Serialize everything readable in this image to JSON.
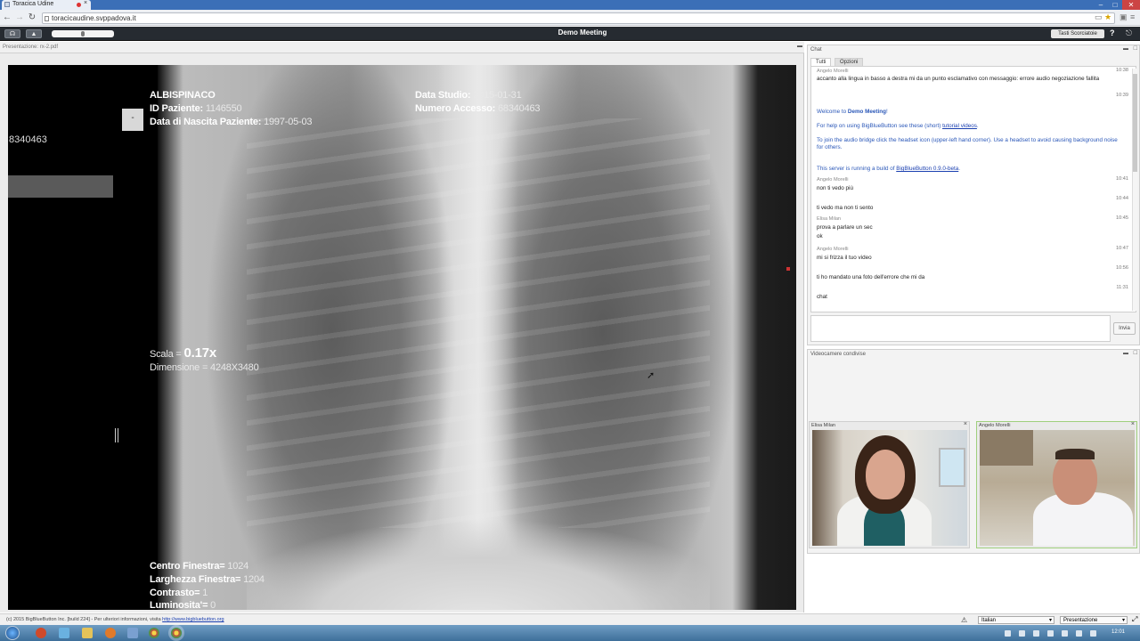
{
  "browser": {
    "tab_title": "Toracica Udine",
    "url": "toracicaudine.svppadova.it"
  },
  "app": {
    "meeting_title": "Demo Meeting",
    "shortcuts_label": "Tasti Scorciatoie",
    "help_label": "?"
  },
  "presentation": {
    "file_name": "Presentazione: rx-2.pdf",
    "minimize_label": "-",
    "overlay": {
      "left_id": "8340463",
      "patient_name": "ALBISPINACO",
      "id_label": "ID Paziente:",
      "id_value": "1146550",
      "birth_label": "Data di Nascita Paziente:",
      "birth_value": "1997-05-03",
      "study_label": "Data Studio:",
      "study_value": "2015-01-31",
      "access_label": "Numero Accesso:",
      "access_value": "68340463",
      "scale_label": "Scala =",
      "scale_value": "0.17x",
      "dim_label": "Dimensione =",
      "dim_value": "4248X3480",
      "center_label": "Centro Finestra=",
      "center_value": "1024",
      "width_label": "Larghezza Finestra=",
      "width_value": "1204",
      "contrast_label": "Contrasto=",
      "contrast_value": "1",
      "lum_label": "Luminosita'=",
      "lum_value": "0"
    }
  },
  "chat": {
    "title": "Chat",
    "tabs": [
      "Tutti",
      "Opzioni"
    ],
    "messages": [
      {
        "sender": "Angelo Morelli",
        "time": "10:38",
        "text": "accanto alla lingua in basso a destra mi da un punto esclamativo con messaggio: errore audio negoziazione fallita"
      },
      {
        "time": "10:39"
      },
      {
        "text_a": "Welcome to ",
        "text_b": "Demo Meeting",
        "text_c": "!"
      },
      {
        "text_a": "For help on using BigBlueButton see these (short) ",
        "link": "tutorial videos",
        "text_c": "."
      },
      {
        "text": "To join the audio bridge click the headset icon (upper-left hand corner).  Use a headset to avoid causing background noise for others."
      },
      {
        "text_a": "This server is running a build of ",
        "link": "BigBlueButton 0.9.0-beta",
        "text_c": "."
      },
      {
        "sender": "Angelo Morelli",
        "time": "10:41",
        "text": "non ti vedo più"
      },
      {
        "time": "10:44",
        "text": "ti vedo ma non ti sento"
      },
      {
        "sender": "Elisa Milan",
        "time": "10:45",
        "text": "prova a parlare un sec"
      },
      {
        "text": "ok"
      },
      {
        "sender": "Angelo Morelli",
        "time": "10:47",
        "text": "mi si frizza il tuo video"
      },
      {
        "time": "10:56",
        "text": "ti ho mandato una foto dell'errore che mi da"
      },
      {
        "time": "11:31",
        "text": "chat"
      }
    ],
    "send_label": "Invia"
  },
  "webcams": {
    "title": "Videocamere condivise",
    "feeds": [
      {
        "name": "Elisa Milan"
      },
      {
        "name": "Angelo Morelli"
      }
    ]
  },
  "footer": {
    "copyright": "(c) 2015 BigBlueButton Inc. [build 224] - Per ulteriori informazioni, visita",
    "link": "http://www.bigbluebutton.org",
    "language": "Italian",
    "layout": "Presentazione"
  },
  "taskbar": {
    "clock": "12:01"
  }
}
